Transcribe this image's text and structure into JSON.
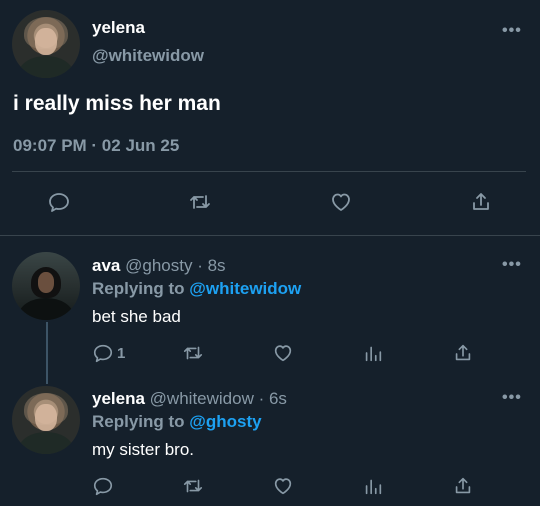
{
  "main_tweet": {
    "display_name": "yelena",
    "handle": "@whitewidow",
    "text": "i really miss her man",
    "timestamp": "09:07 PM · 02 Jun 25",
    "more_icon": "ellipsis-icon",
    "actions": [
      "reply-icon",
      "retweet-icon",
      "like-icon",
      "share-icon"
    ]
  },
  "replies": [
    {
      "display_name": "ava",
      "handle": "@ghosty",
      "time": "· 8s",
      "replying_label": "Replying to",
      "replying_to": "@whitewidow",
      "text": "bet she bad",
      "reply_count": "1"
    },
    {
      "display_name": "yelena",
      "handle": "@whitewidow",
      "time": "· 6s",
      "replying_label": "Replying to",
      "replying_to": "@ghosty",
      "text": "my sister bro."
    }
  ],
  "colors": {
    "background": "#15202b",
    "text": "#ffffff",
    "muted": "#8899a6",
    "link": "#1da1f2",
    "divider": "#38444d"
  }
}
